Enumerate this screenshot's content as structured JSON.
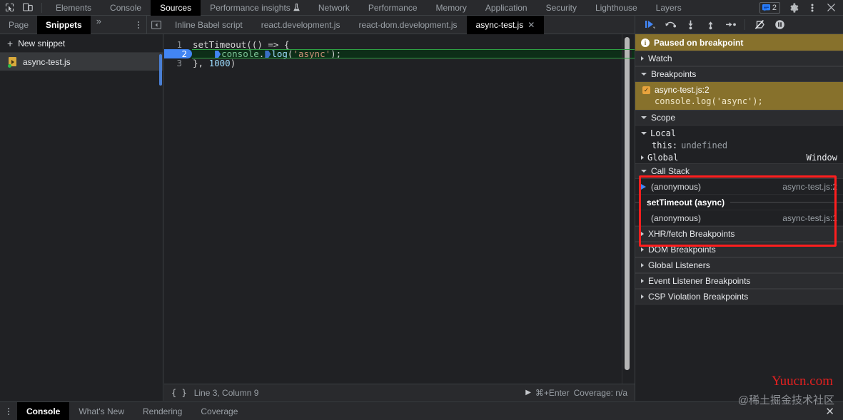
{
  "topbar": {
    "inspect_icon": "inspect-cursor-icon",
    "device_icon": "device-toolbar-icon",
    "tabs": [
      {
        "label": "Elements",
        "active": false
      },
      {
        "label": "Console",
        "active": false
      },
      {
        "label": "Sources",
        "active": true
      },
      {
        "label": "Performance insights",
        "active": false,
        "badge": "experiment-flask-icon"
      },
      {
        "label": "Network",
        "active": false
      },
      {
        "label": "Performance",
        "active": false
      },
      {
        "label": "Memory",
        "active": false
      },
      {
        "label": "Application",
        "active": false
      },
      {
        "label": "Security",
        "active": false
      },
      {
        "label": "Lighthouse",
        "active": false
      },
      {
        "label": "Layers",
        "active": false
      }
    ],
    "message_count": "2",
    "settings_icon": "gear-icon",
    "more_icon": "kebab-icon",
    "close_icon": "close-icon"
  },
  "navigator": {
    "tabs": [
      {
        "label": "Page",
        "active": false
      },
      {
        "label": "Snippets",
        "active": true
      }
    ],
    "overflow_label": "»",
    "new_snippet_label": "New snippet",
    "files": [
      {
        "label": "async-test.js",
        "selected": true
      }
    ]
  },
  "editor_tabs": {
    "navigate_icon": "show-navigator-icon",
    "items": [
      {
        "label": "Inline Babel script",
        "active": false,
        "closable": false
      },
      {
        "label": "react.development.js",
        "active": false,
        "closable": false
      },
      {
        "label": "react-dom.development.js",
        "active": false,
        "closable": false
      },
      {
        "label": "async-test.js",
        "active": true,
        "closable": true
      }
    ],
    "show_debugger_icon": "show-debugger-icon"
  },
  "debugger_toolbar": {
    "buttons": [
      {
        "name": "resume-script-button",
        "icon": "resume-icon"
      },
      {
        "name": "step-over-button",
        "icon": "step-over-icon"
      },
      {
        "name": "step-into-button",
        "icon": "step-into-icon"
      },
      {
        "name": "step-out-button",
        "icon": "step-out-icon"
      },
      {
        "name": "step-button",
        "icon": "step-icon"
      },
      {
        "name": "deactivate-breakpoints-button",
        "icon": "deactivate-breakpoints-icon"
      },
      {
        "name": "pause-on-exceptions-button",
        "icon": "pause-circle-icon"
      }
    ]
  },
  "code": {
    "lines": [
      {
        "number": "1",
        "text": "setTimeout(() => {",
        "highlighted": false
      },
      {
        "number": "2",
        "text": "    console.log('async');",
        "highlighted": true
      },
      {
        "number": "3",
        "text": "}, 1000)",
        "highlighted": false
      }
    ]
  },
  "statusbar": {
    "format_icon": "pretty-print-icon",
    "position": "Line 3, Column 9",
    "run_shortcut": "⌘+Enter",
    "coverage": "Coverage: n/a"
  },
  "sidebar": {
    "paused_banner": "Paused on breakpoint",
    "watch": {
      "label": "Watch",
      "expanded": false
    },
    "breakpoints": {
      "label": "Breakpoints",
      "expanded": true,
      "entries": [
        {
          "location": "async-test.js:2",
          "snippet": "console.log('async');",
          "checked": true
        }
      ]
    },
    "scope": {
      "label": "Scope",
      "expanded": true,
      "groups": [
        {
          "name": "Local",
          "expanded": true,
          "value": "",
          "rows": [
            {
              "key": "this:",
              "value": "undefined"
            }
          ]
        },
        {
          "name": "Global",
          "expanded": false,
          "value": "Window",
          "rows": []
        }
      ]
    },
    "call_stack": {
      "label": "Call Stack",
      "expanded": true,
      "frames": [
        {
          "name": "(anonymous)",
          "location": "async-test.js:2",
          "current": true,
          "async_marker": false
        },
        {
          "name": "setTimeout (async)",
          "location": "",
          "current": false,
          "async_marker": true
        },
        {
          "name": "(anonymous)",
          "location": "async-test.js:1",
          "current": false,
          "async_marker": false
        }
      ]
    },
    "xhr_breakpoints": {
      "label": "XHR/fetch Breakpoints",
      "expanded": false
    },
    "other_sections": [
      {
        "label": "DOM Breakpoints",
        "expanded": false
      },
      {
        "label": "Global Listeners",
        "expanded": false
      },
      {
        "label": "Event Listener Breakpoints",
        "expanded": false
      },
      {
        "label": "CSP Violation Breakpoints",
        "expanded": false
      }
    ]
  },
  "drawer": {
    "more_icon": "kebab-icon",
    "tabs": [
      {
        "label": "Console",
        "active": true
      },
      {
        "label": "What's New",
        "active": false
      },
      {
        "label": "Rendering",
        "active": false
      },
      {
        "label": "Coverage",
        "active": false
      }
    ],
    "close_icon": "close-icon"
  },
  "annotation": {
    "highlight_color": "#ff1e1e"
  },
  "watermarks": {
    "primary": "Yuucn.com",
    "secondary": "@稀土掘金技术社区"
  }
}
